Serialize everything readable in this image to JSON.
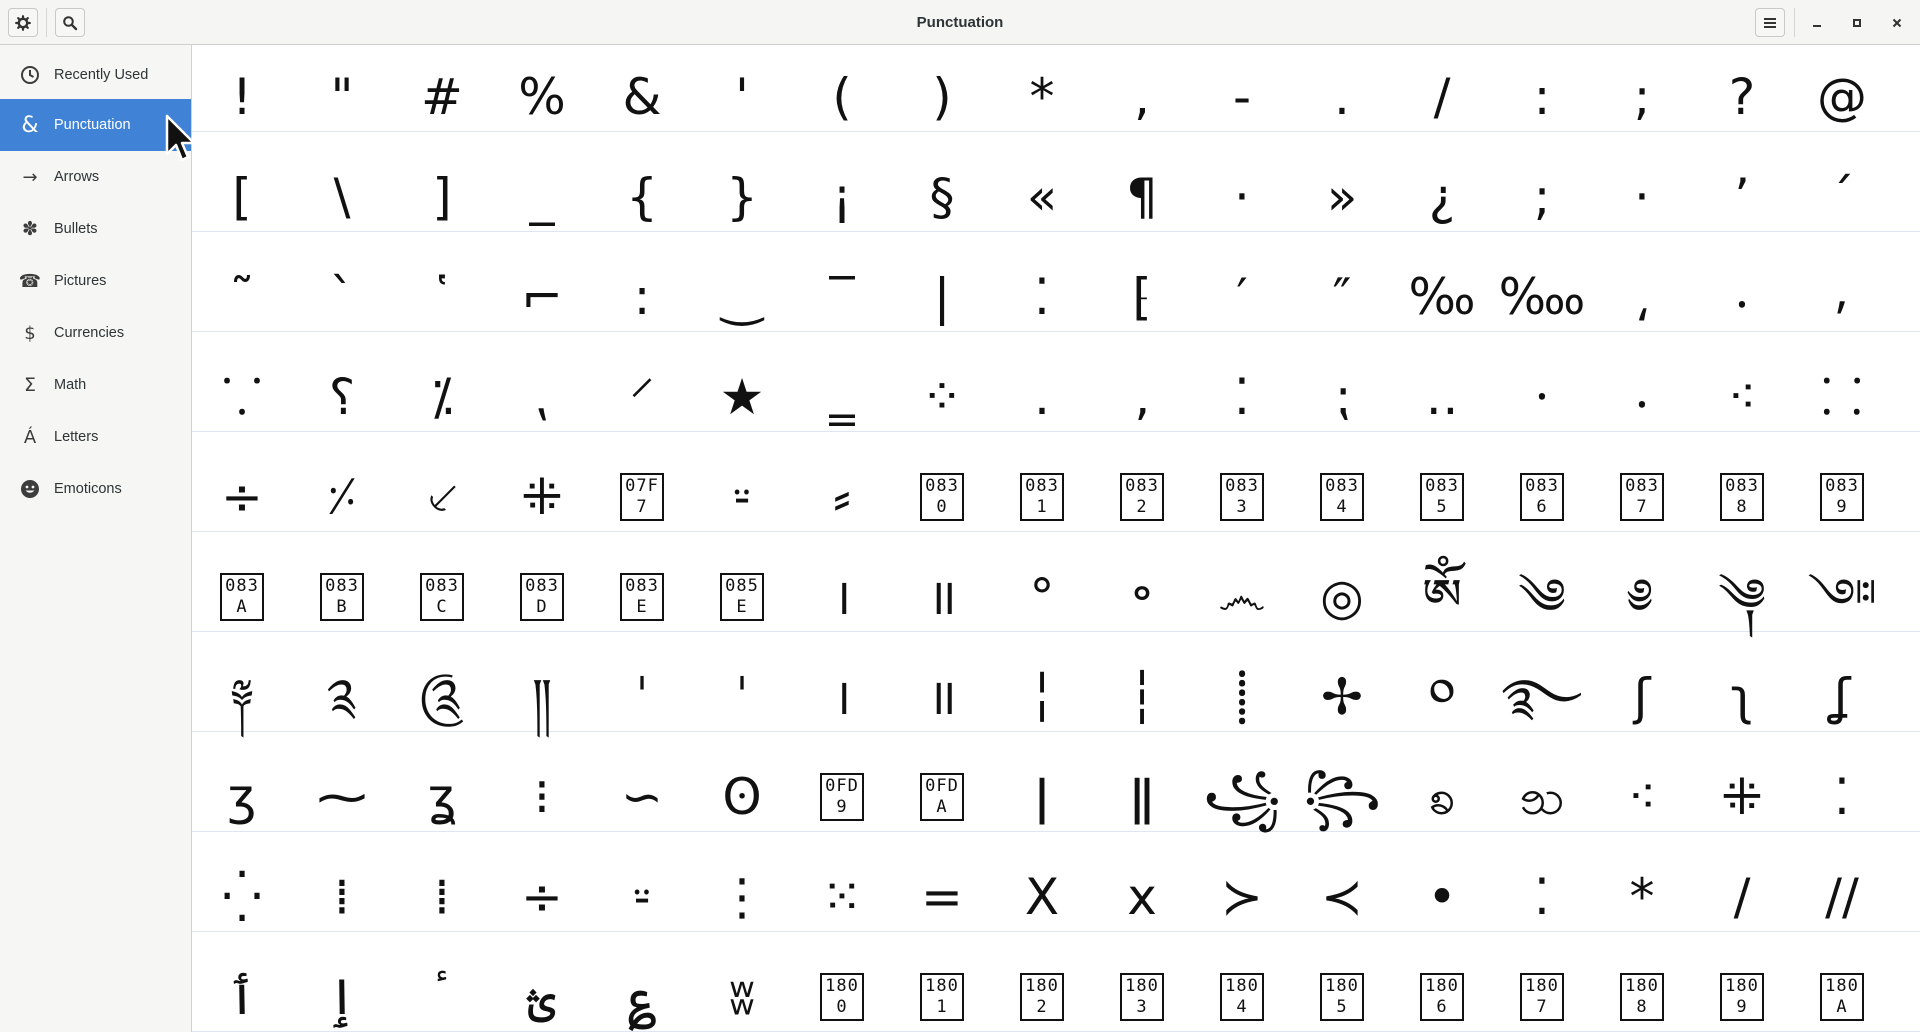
{
  "window": {
    "title": "Punctuation"
  },
  "toolbar": {
    "settings_icon": "gear-icon",
    "search_icon": "search-icon",
    "menu_icon": "hamburger-menu-icon"
  },
  "sidebar": {
    "items": [
      {
        "label": "Recently Used",
        "icon": "clock-icon",
        "active": false
      },
      {
        "label": "Punctuation",
        "icon": "ampersand-icon",
        "active": true
      },
      {
        "label": "Arrows",
        "icon": "arrow-icon",
        "active": false
      },
      {
        "label": "Bullets",
        "icon": "bullet-icon",
        "active": false
      },
      {
        "label": "Pictures",
        "icon": "telephone-icon",
        "active": false
      },
      {
        "label": "Currencies",
        "icon": "dollar-icon",
        "active": false
      },
      {
        "label": "Math",
        "icon": "sigma-icon",
        "active": false
      },
      {
        "label": "Letters",
        "icon": "letter-icon",
        "active": false
      },
      {
        "label": "Emoticons",
        "icon": "smiley-icon",
        "active": false
      }
    ]
  },
  "colors": {
    "accent": "#3f82d6",
    "sidebar_bg": "#f6f6f5",
    "titlebar_bg": "#f5f5f4",
    "row_line": "#dfe6ef"
  },
  "characters": [
    [
      "!",
      "\"",
      "#",
      "%",
      "&",
      "'",
      "(",
      ")",
      "*",
      ",",
      "-",
      ".",
      "/",
      ":",
      ";",
      "?",
      "@"
    ],
    [
      "[",
      "\\",
      "]",
      "_",
      "{",
      "}",
      "¡",
      "§",
      "«",
      "¶",
      "·",
      "»",
      "¿",
      ";",
      "·",
      "ʼ",
      "ˊ"
    ],
    [
      "῀",
      "`",
      "῾",
      "⌐",
      ":",
      "‿",
      "‾",
      "|",
      "⁚",
      "⁅",
      "′",
      "″",
      "‰",
      "‱",
      "⸲",
      "⸳",
      "⸴"
    ],
    [
      "⸪",
      "⸮",
      "⁒",
      "⹁",
      "⸍",
      "★",
      "‗",
      "⁘",
      "․",
      "‚",
      "⁚",
      "⁏",
      "‥",
      "⸱",
      "⸳",
      "⁖",
      "⸬"
    ],
    [
      "÷",
      "⸓",
      "⸔",
      "⁜",
      "07F7",
      "⸚",
      "⸗",
      "0830",
      "0831",
      "0832",
      "0833",
      "0834",
      "0835",
      "0836",
      "0837",
      "0838",
      "0839"
    ],
    [
      "083A",
      "083B",
      "083C",
      "083D",
      "083E",
      "085E",
      "।",
      "॥",
      "°",
      "॰",
      "෴",
      "◎",
      "ༀ",
      "༄",
      "༅",
      "༆",
      "༇"
    ],
    [
      "༈",
      "༉",
      "༊",
      "༎",
      "ˈ",
      "ˈ",
      "।",
      "॥",
      "╎",
      "┆",
      "⸽",
      "✢",
      "༠",
      "࿐",
      "ʃ",
      "ʅ",
      "ʆ"
    ],
    [
      "ʒ",
      "⁓",
      "ʓ",
      "⁝",
      "∽",
      "ʘ",
      "0FD9",
      "0FDA",
      "ǀ",
      "ǁ",
      "꧁",
      "꧂",
      "ꧠ",
      "ꧡ",
      "⁖",
      "⁜",
      "⁚"
    ],
    [
      "⁛",
      "⁞",
      "⁞",
      "÷",
      "⸚",
      "⋮",
      "⁙",
      "=",
      "X",
      "x",
      "≻",
      "≺",
      "•",
      "⁚",
      "*",
      "/",
      "//"
    ],
    [
      "ٲ",
      "ٳ",
      "ٴ",
      "ؿ",
      "؏",
      "ʬ",
      "1800",
      "1801",
      "1802",
      "1803",
      "1804",
      "1805",
      "1806",
      "1807",
      "1808",
      "1809",
      "180A"
    ]
  ]
}
